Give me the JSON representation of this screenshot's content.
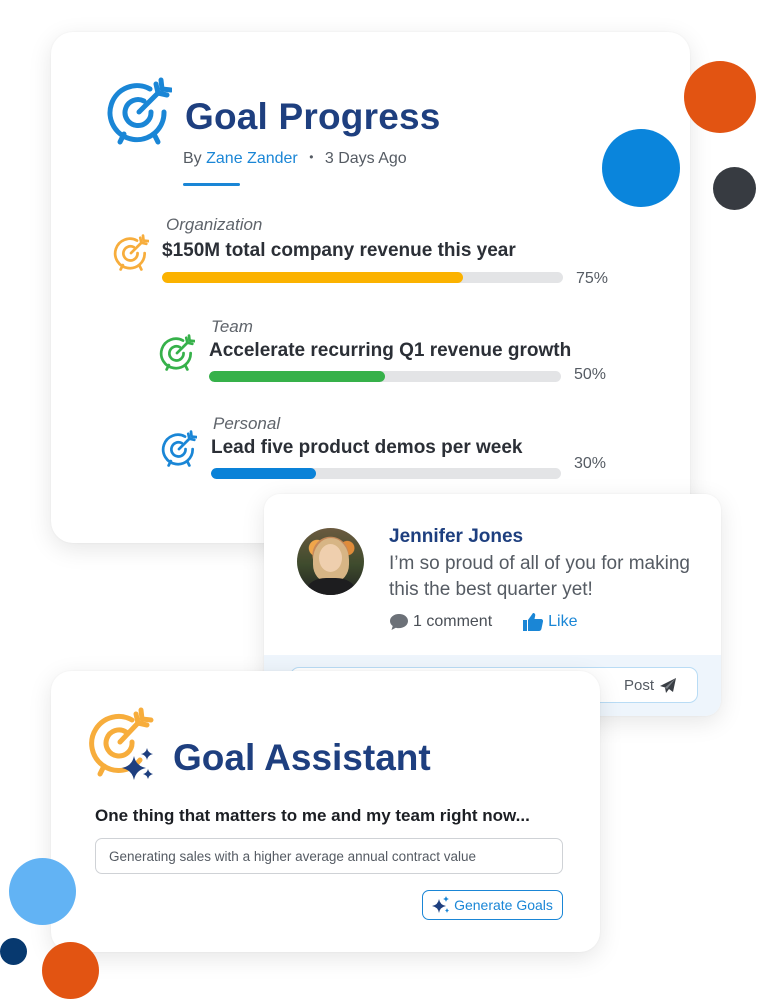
{
  "colors": {
    "brand_navy": "#1e3f7f",
    "accent_blue": "#1a86d6",
    "org_amber": "#fbb200",
    "team_green": "#36b14a",
    "personal_blue": "#0a82d8",
    "icon_orange": "#f7ad3c",
    "track_gray": "#e3e4e6"
  },
  "goal_progress": {
    "title": "Goal Progress",
    "by_label": "By",
    "author": "Zane Zander",
    "separator": "•",
    "time_ago": "3 Days Ago",
    "goals": [
      {
        "category": "Organization",
        "title": "$150M total company revenue this year",
        "progress": 0.75,
        "progress_label": "75%",
        "icon": "target-icon",
        "color": "#fbb200",
        "icon_color": "#f7ad3c"
      },
      {
        "category": "Team",
        "title": "Accelerate recurring Q1 revenue growth",
        "progress": 0.5,
        "progress_label": "50%",
        "icon": "target-icon",
        "color": "#36b14a",
        "icon_color": "#36b14a"
      },
      {
        "category": "Personal",
        "title": "Lead five product demos per week",
        "progress": 0.3,
        "progress_label": "30%",
        "icon": "target-icon",
        "color": "#0a82d8",
        "icon_color": "#1a86d6"
      }
    ]
  },
  "comment": {
    "author": "Jennifer Jones",
    "text": "I’m so proud of all of you for making this the best quarter yet!",
    "comment_count_label": "1 comment",
    "like_label": "Like",
    "post_label": "Post",
    "reply_value": ""
  },
  "goal_assistant": {
    "title": "Goal Assistant",
    "prompt": "One thing that matters to me and my team right now...",
    "input_value": "Generating sales with a higher average annual contract value",
    "button_label": "Generate Goals"
  }
}
